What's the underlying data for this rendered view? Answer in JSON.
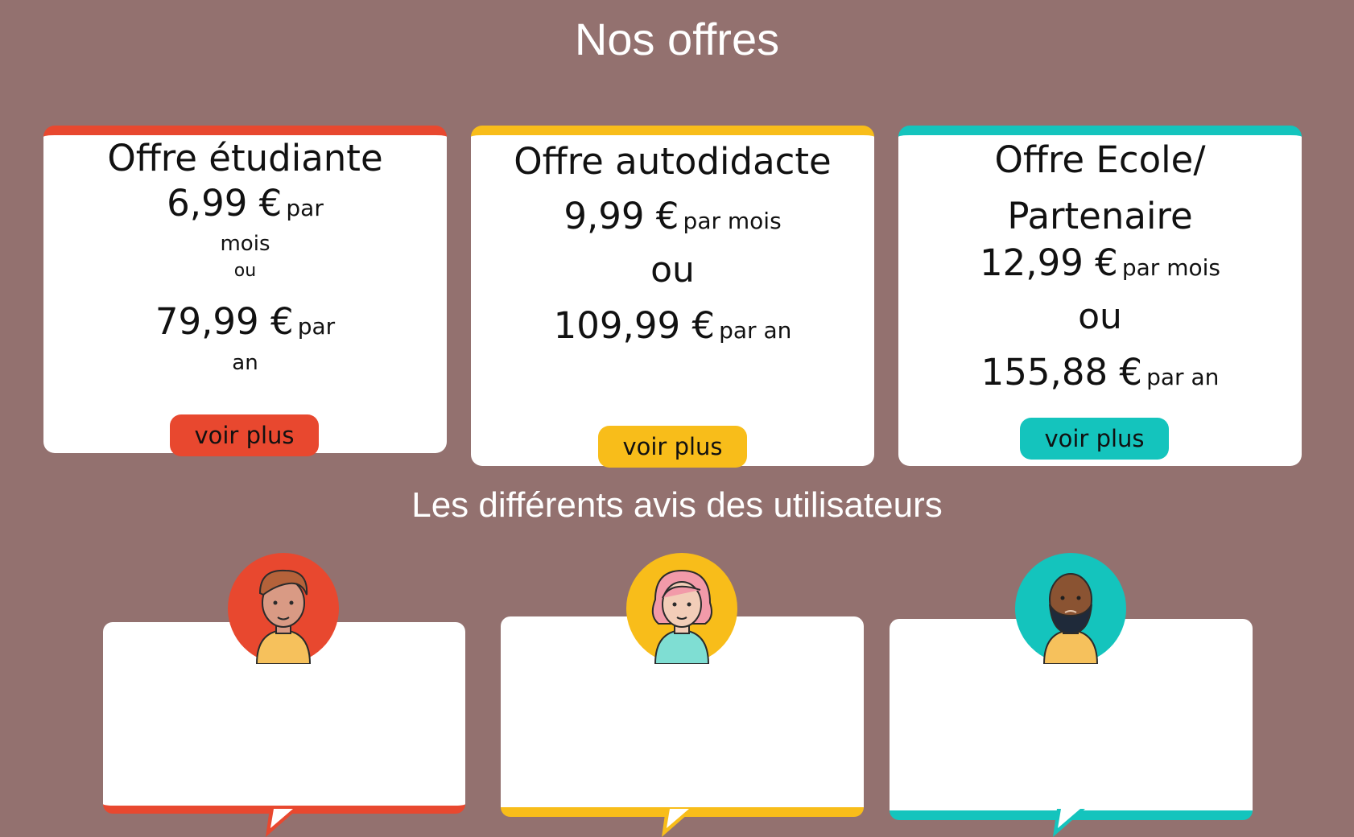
{
  "offers_title": "Nos offres",
  "reviews_title": "Les différents avis des utilisateurs",
  "offers": [
    {
      "name": "Offre étudiante",
      "monthly_price": "6,99 €",
      "monthly_unit_a": "par",
      "monthly_unit_b": "mois",
      "or": "ou",
      "yearly_price": "79,99 €",
      "yearly_unit_a": "par",
      "yearly_unit_b": "an",
      "button": "voir plus",
      "accent": "#e8482f"
    },
    {
      "name": "Offre autodidacte",
      "monthly_price": "9,99 €",
      "monthly_unit": "par mois",
      "or": "ou",
      "yearly_price": "109,99 €",
      "yearly_unit": "par an",
      "button": "voir plus",
      "accent": "#f8bd1a"
    },
    {
      "name_line1": "Offre Ecole/",
      "name_line2": "Partenaire",
      "monthly_price": "12,99 €",
      "monthly_unit": "par mois",
      "or": "ou",
      "yearly_price": "155,88 €",
      "yearly_unit": "par an",
      "button": "voir plus",
      "accent": "#14c4bd"
    }
  ],
  "reviews": [
    {
      "avatar": "young-man-avatar",
      "accent": "#e8482f"
    },
    {
      "avatar": "woman-avatar",
      "accent": "#f8bd1a"
    },
    {
      "avatar": "bearded-man-avatar",
      "accent": "#14c4bd"
    }
  ]
}
